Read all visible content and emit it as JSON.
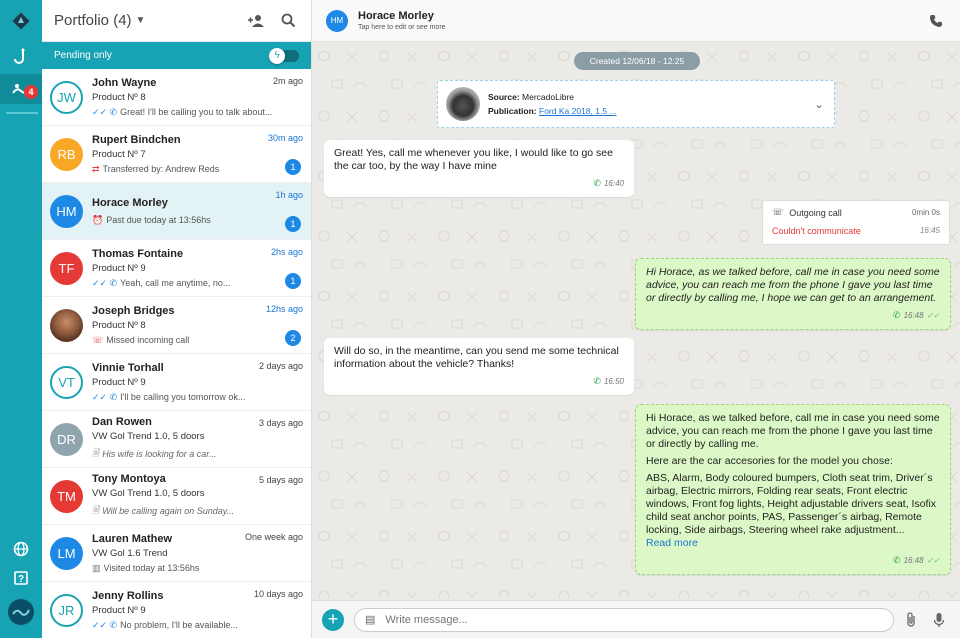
{
  "rail": {
    "badge": "4"
  },
  "sidebar": {
    "title": "Portfolio (4)",
    "filter_label": "Pending only",
    "items": [
      {
        "initials": "JW",
        "name": "John Wayne",
        "product": "Product Nº 8",
        "time": "2m ago",
        "preview": "Great! I'll be calling you to talk about...",
        "count": "",
        "color": "#17a3b4",
        "outline": true,
        "icon": "check-whatsapp",
        "italic": false
      },
      {
        "initials": "RB",
        "name": "Rupert Bindchen",
        "product": "Product Nº 7",
        "time": "30m ago",
        "preview": "Transferred by: Andrew Reds",
        "count": "1",
        "color": "#f9a825",
        "outline": false,
        "icon": "transfer",
        "italic": false
      },
      {
        "initials": "HM",
        "name": "Horace Morley",
        "product": "",
        "time": "1h ago",
        "preview": "Past due today at 13:56hs",
        "count": "1",
        "color": "#1e88e5",
        "outline": false,
        "icon": "alarm",
        "italic": false
      },
      {
        "initials": "TF",
        "name": "Thomas Fontaine",
        "product": "Product Nº 9",
        "time": "2hs ago",
        "preview": "Yeah, call me anytime, no...",
        "count": "1",
        "color": "#e53935",
        "outline": false,
        "icon": "check-whatsapp",
        "italic": false
      },
      {
        "initials": "",
        "name": "Joseph Bridges",
        "product": "Product Nº 8",
        "time": "12hs ago",
        "preview": "Missed incoming call",
        "count": "2",
        "color": "#8d5a3b",
        "outline": false,
        "icon": "missed-call",
        "italic": false
      },
      {
        "initials": "VT",
        "name": "Vinnie Torhall",
        "product": "Product Nº 9",
        "time": "2 days ago",
        "preview": "I'll be calling you tomorrow ok...",
        "count": "",
        "color": "#17a3b4",
        "outline": true,
        "icon": "check-whatsapp",
        "italic": false
      },
      {
        "initials": "DR",
        "name": "Dan Rowen",
        "product": "VW Gol Trend 1.0, 5 doors",
        "time": "3 days ago",
        "preview": "His wife is looking for a car...",
        "count": "",
        "color": "#90a4ae",
        "outline": false,
        "icon": "note",
        "italic": true
      },
      {
        "initials": "TM",
        "name": "Tony Montoya",
        "product": "VW Gol Trend 1.0, 5 doors",
        "time": "5 days ago",
        "preview": "Will be calling again on Sunday...",
        "count": "",
        "color": "#e53935",
        "outline": false,
        "icon": "note",
        "italic": true
      },
      {
        "initials": "LM",
        "name": "Lauren Mathew",
        "product": "VW Gol 1.6 Trend",
        "time": "One week ago",
        "preview": "Visited today at 13:56hs",
        "count": "",
        "color": "#1e88e5",
        "outline": false,
        "icon": "visit",
        "italic": false
      },
      {
        "initials": "JR",
        "name": "Jenny Rollins",
        "product": "Product Nº 9",
        "time": "10 days ago",
        "preview": "No problem, I'll be available...",
        "count": "",
        "color": "#17a3b4",
        "outline": true,
        "icon": "check-whatsapp",
        "italic": false
      }
    ]
  },
  "chat": {
    "avatar": "HM",
    "name": "Horace Morley",
    "subtitle": "Tap here to edit or see more",
    "created": "Created 12/06/18 - 12:25",
    "source_label": "Source:",
    "source_value": "MercadoLibre",
    "publication_label": "Publication:",
    "publication_value": "Ford Ka 2018, 1.5 ...",
    "msg1": "Great! Yes, call me whenever you like, I would like to go see the car too, by the way I have mine",
    "msg1_time": "16:40",
    "call_label": "Outgoing call",
    "call_duration": "0min 0s",
    "call_status": "Couldn't communicate",
    "call_time": "16:45",
    "msg2": "Hi Horace, as we talked before, call me in case you need some advice, you can reach me from the phone I gave you last time or directly by calling me, I hope we can get to an arrangement.",
    "msg2_time": "16:48",
    "msg3": "Will do so, in the meantime, can you send me some technical information about the vehicle? Thanks!",
    "msg3_time": "16:50",
    "msg4_p1": "Hi Horace, as we talked before, call me in case you need some advice, you can reach me from the phone I gave you last time or directly by calling me.",
    "msg4_p2": "Here are the car accesories for the model you chose:",
    "msg4_p3": "ABS, Alarm, Body coloured bumpers, Cloth seat trim, Driver´s airbag, Electric mirrors, Folding rear seats, Front electric windows, Front fog lights, Height adjustable drivers seat, Isofix child seat anchor points, PAS, Passenger´s airbag, Remote locking, Side airbags, Steering wheel rake adjustment...",
    "msg4_more": "Read more",
    "msg4_time": "16:48",
    "input_placeholder": "Write message..."
  }
}
